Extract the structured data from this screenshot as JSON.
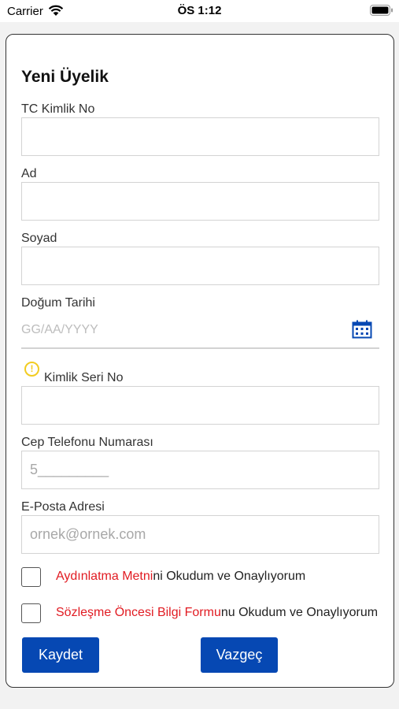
{
  "status_bar": {
    "carrier": "Carrier",
    "time": "ÖS 1:12"
  },
  "form": {
    "title": "Yeni Üyelik",
    "fields": {
      "tc_label": "TC Kimlik No",
      "tc_value": "",
      "name_label": "Ad",
      "name_value": "",
      "surname_label": "Soyad",
      "surname_value": "",
      "birthdate_label": "Doğum Tarihi",
      "birthdate_placeholder": "GG/AA/YYYY",
      "serial_label": "Kimlik Seri No",
      "serial_value": "",
      "phone_label": "Cep Telefonu Numarası",
      "phone_placeholder": "5_________",
      "email_label": "E-Posta Adresi",
      "email_placeholder": "ornek@ornek.com"
    },
    "consents": [
      {
        "link": "Aydınlatma Metni",
        "rest": "ni Okudum ve Onaylıyorum",
        "checked": false
      },
      {
        "link": "Sözleşme Öncesi Bilgi Formu",
        "rest": "nu Okudum ve Onaylıyorum",
        "checked": false
      }
    ],
    "buttons": {
      "save": "Kaydet",
      "cancel": "Vazgeç"
    }
  },
  "icons": {
    "wifi": "wifi-icon",
    "battery": "battery-icon",
    "calendar": "calendar-icon",
    "warning": "warning-icon"
  },
  "colors": {
    "primary": "#0648b3",
    "link": "#e11b22",
    "warning": "#f2cc21"
  }
}
